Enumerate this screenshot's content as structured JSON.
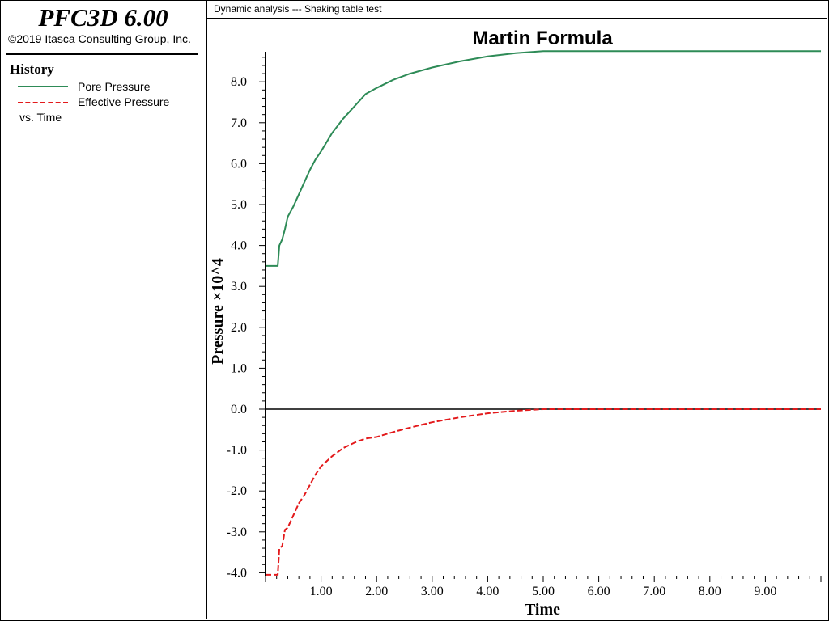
{
  "app": {
    "title": "PFC3D 6.00",
    "copyright": "©2019 Itasca Consulting Group, Inc."
  },
  "plot_caption": "Dynamic analysis --- Shaking table test",
  "legend": {
    "title": "History",
    "items": [
      {
        "label": "Pore Pressure",
        "color": "#2e8b57",
        "style": "solid"
      },
      {
        "label": "Effective Pressure",
        "color": "#e31a1c",
        "style": "dashed"
      }
    ],
    "vs_label": "vs. Time"
  },
  "chart_data": {
    "type": "line",
    "title": "Martin Formula",
    "xlabel": "Time",
    "ylabel": "Pressure ×10^4",
    "xlim": [
      0,
      10
    ],
    "ylim": [
      -4.05,
      8.8
    ],
    "x_ticks": [
      1,
      2,
      3,
      4,
      5,
      6,
      7,
      8,
      9
    ],
    "x_tick_labels": [
      "1.00",
      "2.00",
      "3.00",
      "4.00",
      "5.00",
      "6.00",
      "7.00",
      "8.00",
      "9.00"
    ],
    "y_ticks": [
      -4,
      -3,
      -2,
      -1,
      0,
      1,
      2,
      3,
      4,
      5,
      6,
      7,
      8
    ],
    "y_tick_labels": [
      "-4.0",
      "-3.0",
      "-2.0",
      "-1.0",
      "0.0",
      "1.0",
      "2.0",
      "3.0",
      "4.0",
      "5.0",
      "6.0",
      "7.0",
      "8.0"
    ],
    "zero_line": true,
    "grid": false,
    "series": [
      {
        "name": "Pore Pressure",
        "color": "#2e8b57",
        "style": "solid",
        "x": [
          0,
          0.22,
          0.25,
          0.3,
          0.35,
          0.4,
          0.5,
          0.6,
          0.7,
          0.8,
          0.9,
          1.0,
          1.2,
          1.4,
          1.6,
          1.8,
          2.0,
          2.3,
          2.6,
          3.0,
          3.5,
          4.0,
          4.5,
          5.0,
          5.5,
          6.0,
          7.0,
          8.0,
          9.0,
          10.0
        ],
        "y": [
          3.5,
          3.5,
          4.0,
          4.15,
          4.4,
          4.7,
          4.95,
          5.25,
          5.55,
          5.85,
          6.1,
          6.3,
          6.75,
          7.1,
          7.4,
          7.7,
          7.85,
          8.05,
          8.2,
          8.35,
          8.5,
          8.62,
          8.7,
          8.75,
          8.75,
          8.75,
          8.75,
          8.75,
          8.75,
          8.75
        ]
      },
      {
        "name": "Effective Pressure",
        "color": "#e31a1c",
        "style": "dashed",
        "x": [
          0,
          0.22,
          0.25,
          0.3,
          0.35,
          0.4,
          0.5,
          0.6,
          0.7,
          0.8,
          0.9,
          1.0,
          1.2,
          1.4,
          1.6,
          1.8,
          2.0,
          2.3,
          2.6,
          3.0,
          3.5,
          4.0,
          4.5,
          5.0,
          5.5,
          6.0,
          7.0,
          8.0,
          9.0,
          10.0
        ],
        "y": [
          -4.05,
          -4.05,
          -3.4,
          -3.35,
          -2.95,
          -2.9,
          -2.6,
          -2.3,
          -2.1,
          -1.85,
          -1.6,
          -1.4,
          -1.15,
          -0.95,
          -0.82,
          -0.72,
          -0.68,
          -0.56,
          -0.45,
          -0.32,
          -0.2,
          -0.1,
          -0.04,
          0,
          0,
          0,
          0,
          0,
          0,
          0
        ]
      }
    ]
  }
}
